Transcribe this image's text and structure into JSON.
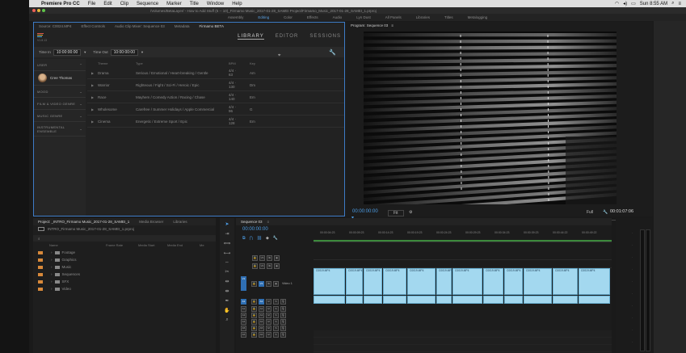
{
  "menubar": {
    "app": "Premiere Pro CC",
    "items": [
      "File",
      "Edit",
      "Clip",
      "Sequence",
      "Marker",
      "Title",
      "Window",
      "Help"
    ],
    "clock": "Sun 8:55 AM"
  },
  "titlebar": {
    "title": "/Volumes/BetaLayer/ - How to Add Stuff (5 -- 10)_Firmamo Music_2017-01-28_SAMEI Project/Firmamo_Music_2017-01-28_SAMEI_1.prproj"
  },
  "workspaces": {
    "items": [
      "Assembly",
      "Editing",
      "Color",
      "Effects",
      "Audio",
      "Lyn Dust",
      "All Panels",
      "Libraries",
      "Titles",
      "Metalogging"
    ],
    "active": "Editing"
  },
  "musicbed": {
    "tabs": [
      "Source: C0024.MP4",
      "Effect Controls",
      "Audio Clip Mixer: Sequence 03",
      "Metadata",
      "Firmamo BETA"
    ],
    "active_tab": "Firmamo BETA",
    "version": "V1.8.13",
    "nav": [
      "LIBRARY",
      "EDITOR",
      "SESSIONS"
    ],
    "nav_active": "LIBRARY",
    "time_in_label": "Time In",
    "time_in": "10:00:00:00",
    "time_out_label": "Time Out",
    "time_out": "10:00:00:00",
    "sidebar": {
      "user_section": "USER",
      "user_name": "Cree Thomas",
      "sections": [
        "MOOD",
        "FILM & VIDEO GENRE",
        "MUSIC GENRE",
        "INSTRUMENTAL ENSEMBLE"
      ]
    },
    "columns": {
      "name": "Theme",
      "type": "Type",
      "bpm": "BPM",
      "key": "Key"
    },
    "rows": [
      {
        "name": "Drama",
        "type": "Serious / Emotional / Heart-breaking / Gentle",
        "bpm": "4/4 · 63",
        "key": "Am"
      },
      {
        "name": "Warrior",
        "type": "Righteous / Fight / Sci-Fi / Heroic / Epic",
        "bpm": "4/4 · 130",
        "key": "Dm"
      },
      {
        "name": "Race",
        "type": "Mayhem / Comedy Action / Racing / Chase",
        "bpm": "4/4 · 140",
        "key": "Em"
      },
      {
        "name": "Wholesome",
        "type": "Carefree / Summer Holidays / Apple Commercial",
        "bpm": "4/4 · 96",
        "key": "G"
      },
      {
        "name": "Cinema",
        "type": "Energetic / Extreme Sport / Epic",
        "bpm": "4/4 · 128",
        "key": "Em"
      }
    ]
  },
  "program": {
    "tab": "Program: Sequence 03",
    "timecode": "00:00:00:00",
    "fit": "Fit",
    "quality": "Full",
    "duration": "00:01:07:06"
  },
  "project": {
    "tabs": [
      "Project: _INTRO_Firmamo Music_2017-01-28_SAMEI_1",
      "Media Browser",
      "Libraries"
    ],
    "path": "INTRO_Firmamo Music_2017-01-28_SAMEI_1.prproj",
    "columns": [
      "Name",
      "Frame Rate",
      "Media Start",
      "Media End",
      "Me"
    ],
    "items": [
      "Footage",
      "Graphics",
      "Music",
      "Sequences",
      "SFX",
      "Video"
    ]
  },
  "timeline": {
    "tab": "Sequence 03",
    "timecode": "00:00:00:00",
    "ruler": [
      "00:00:04:23",
      "00:00:09:23",
      "00:00:14:23",
      "00:00:19:23",
      "00:00:24:23",
      "00:00:29:23",
      "00:00:34:23",
      "00:00:39:23",
      "00:00:44:22",
      "00:00:49:22"
    ],
    "video_tracks": [
      "V3",
      "V2",
      "V1"
    ],
    "audio_tracks": [
      "A1",
      "A2",
      "A3",
      "A4",
      "A5",
      "A6"
    ],
    "v1_name": "Video 1",
    "clip_name": "C0019.MP4"
  },
  "colors": {
    "accent": "#4d9fe8",
    "clip": "#a3d8ef",
    "folder": "#d8893a",
    "panel_border": "#3e7cc7"
  }
}
